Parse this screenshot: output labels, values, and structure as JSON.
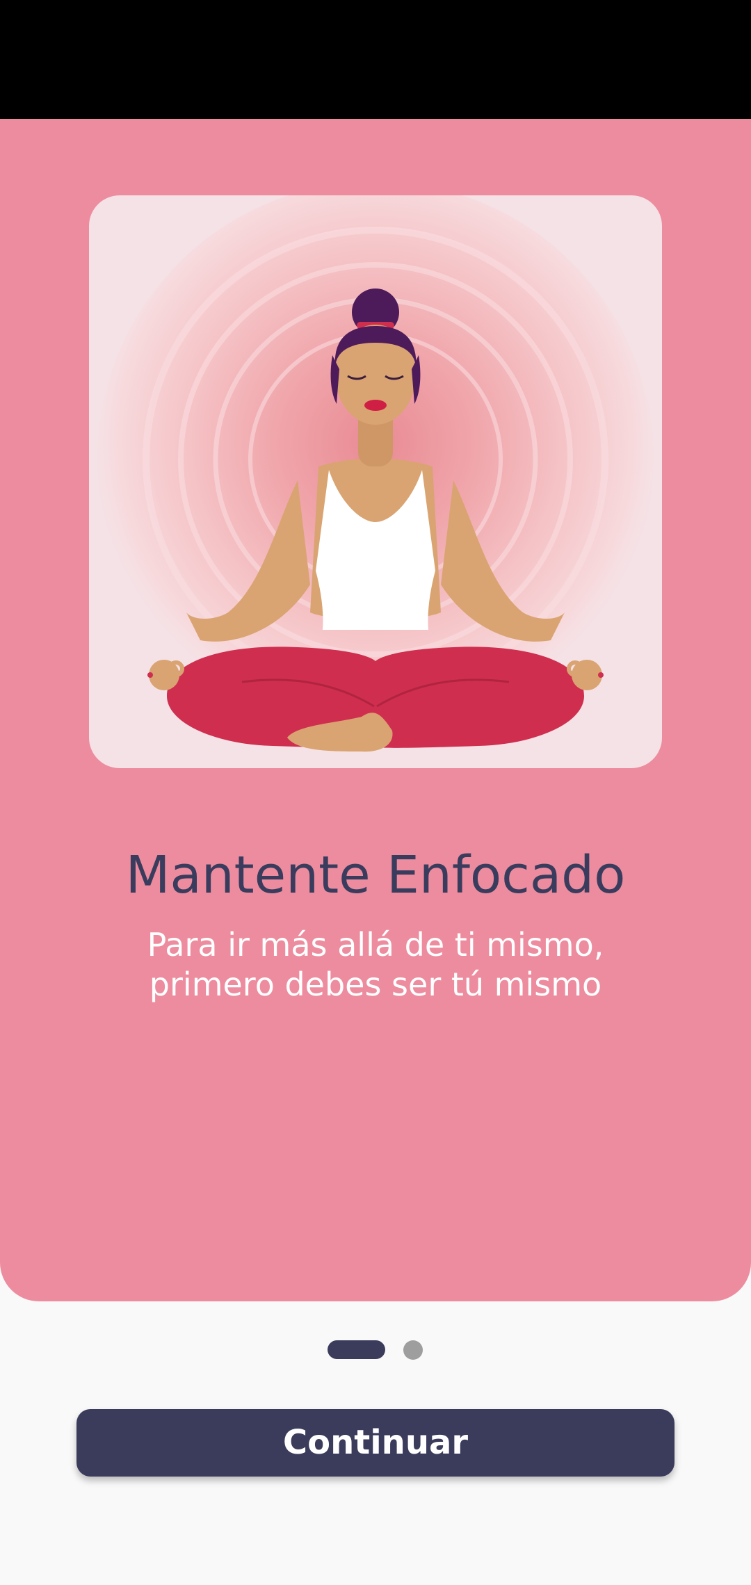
{
  "onboarding": {
    "title": "Mantente Enfocado",
    "subtitle": "Para ir más allá de ti mismo, primero debes ser tú mismo",
    "illustration": "meditating-woman-illustration"
  },
  "pager": {
    "page_count": 2,
    "current_page": 1
  },
  "actions": {
    "continue_label": "Continuar"
  },
  "colors": {
    "status_bar": "#000000",
    "panel_background": "#ed8c9e",
    "card_background": "#f5e2e6",
    "title_text": "#3a3c5e",
    "subtitle_text": "#ffffff",
    "button_background": "#3b3c5c",
    "dot_active": "#3b3c5c",
    "dot_inactive": "#9e9e9e",
    "page_background": "#f9f9f9"
  }
}
